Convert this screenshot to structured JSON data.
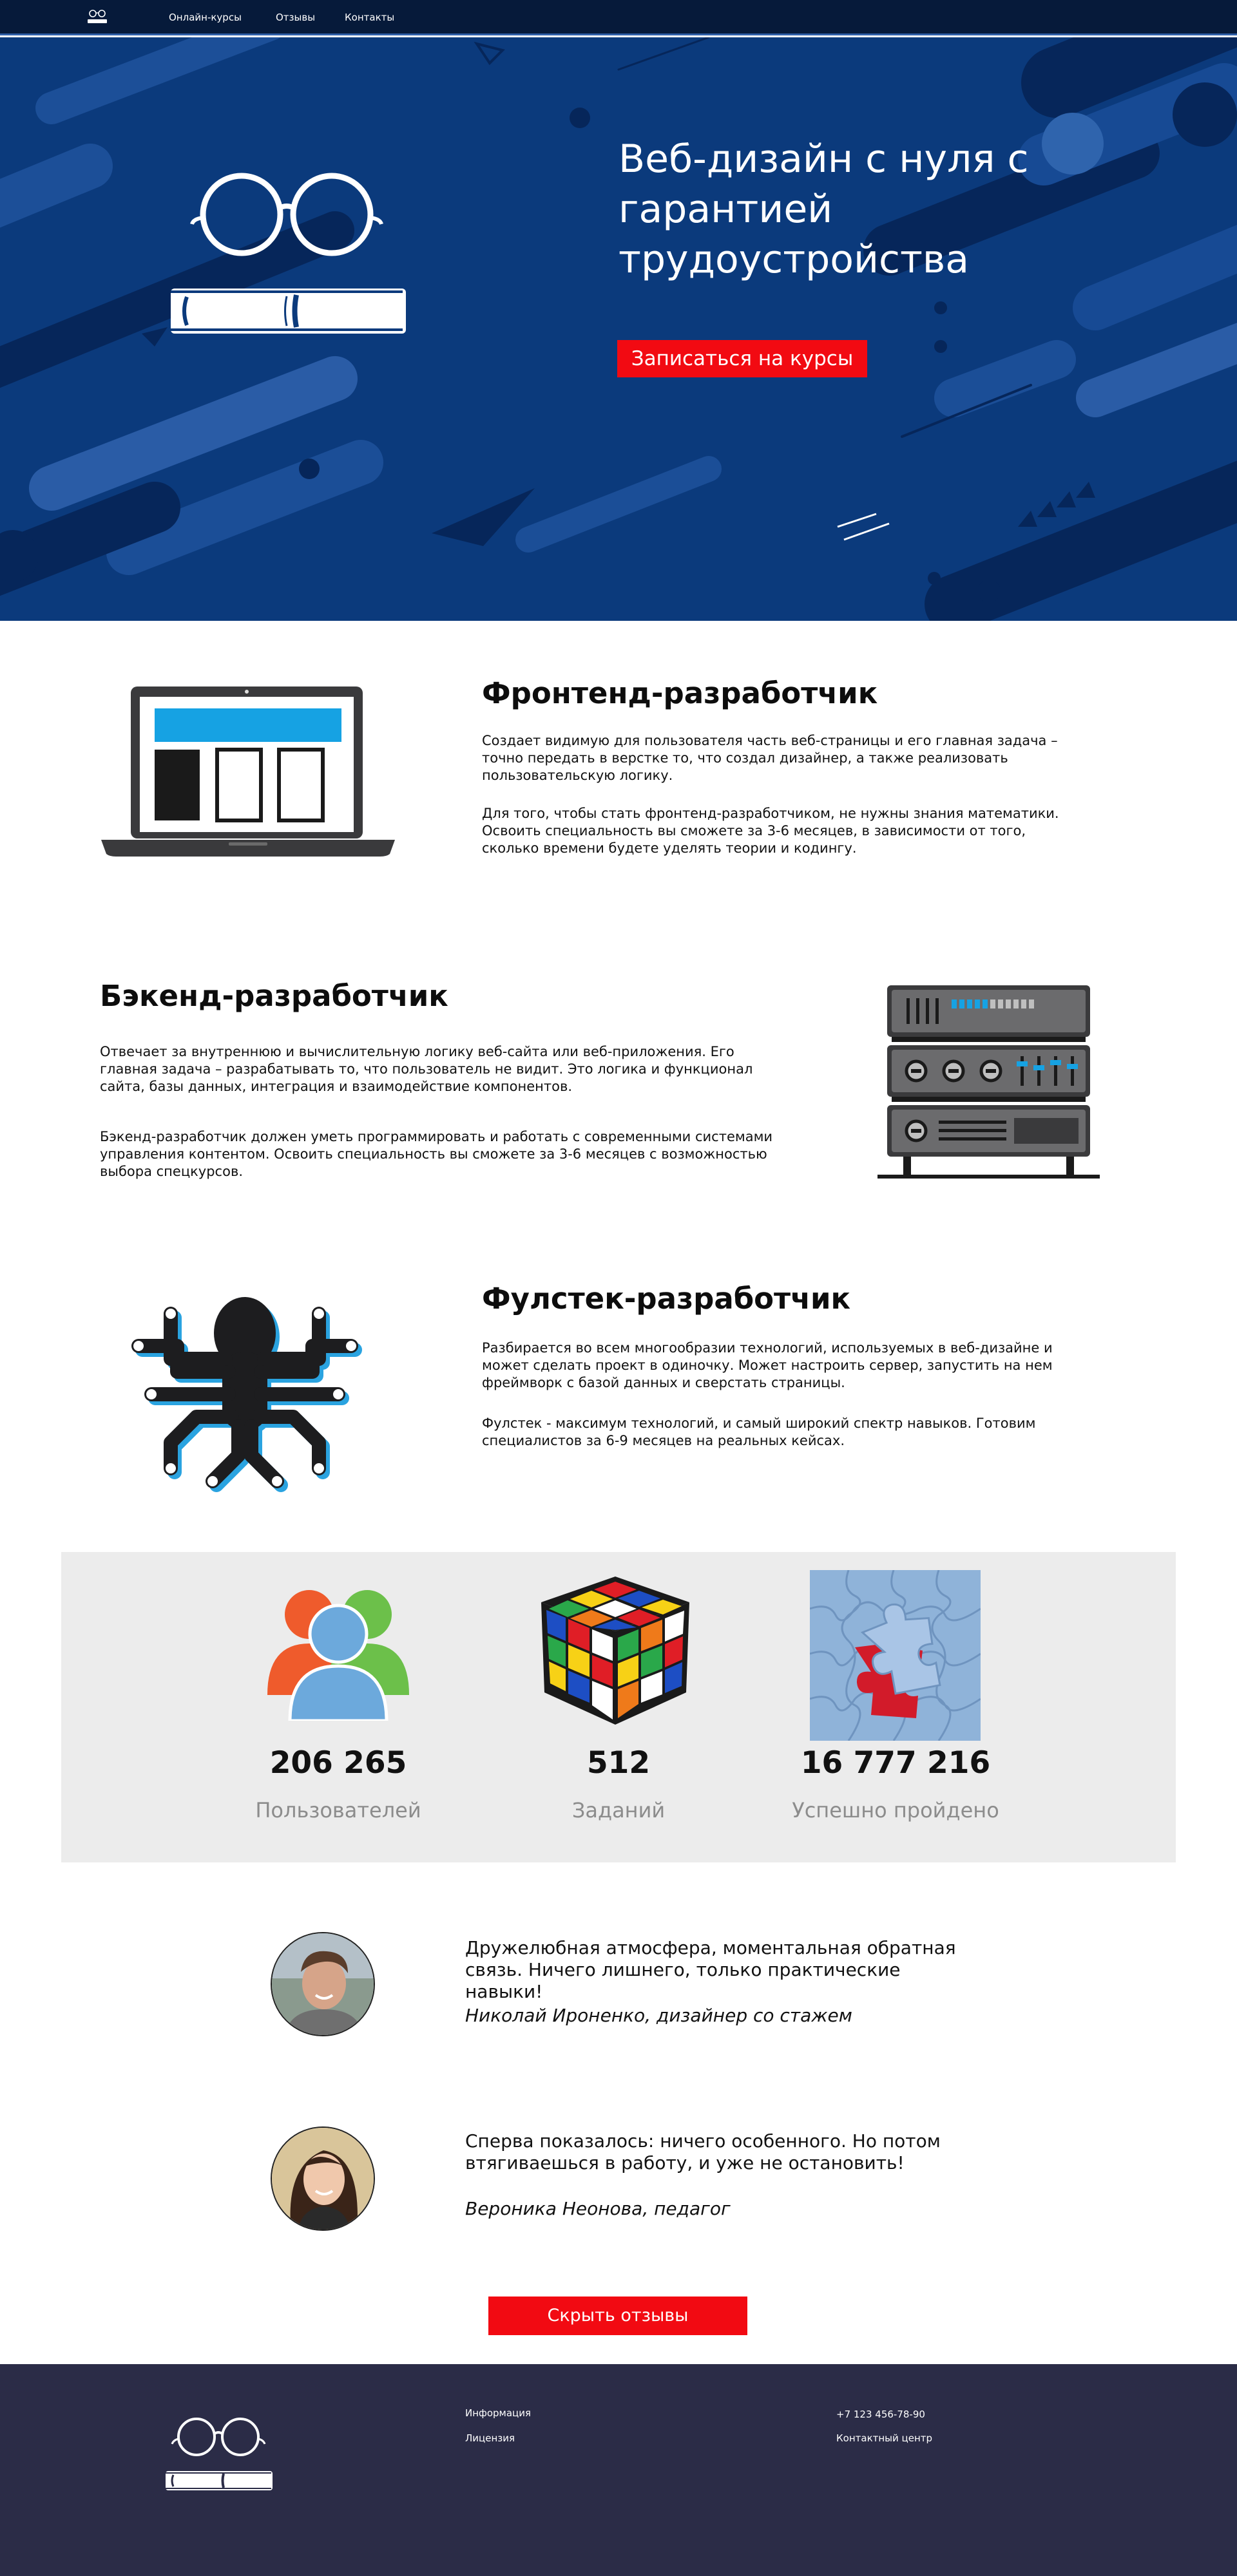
{
  "nav": {
    "links": [
      "Онлайн-курсы",
      "Отзывы",
      "Контакты"
    ]
  },
  "hero": {
    "title": "Веб-дизайн с нуля с гарантией трудоустройства",
    "button": "Записаться на курсы"
  },
  "frontend": {
    "title": "Фронтенд-разработчик",
    "p1": "Создает видимую для пользователя часть веб-страницы и его главная задача – точно передать в верстке то, что создал дизайнер, а также реализовать пользовательскую логику.",
    "p2": "Для того, чтобы стать фронтенд-разработчиком, не нужны знания математики. Освоить специальность вы сможете за 3-6 месяцев, в зависимости от того, сколько времени будете уделять теории и кодингу."
  },
  "backend": {
    "title": "Бэкенд-разработчик",
    "p1": "Отвечает за внутреннюю и вычислительную логику веб-сайта или веб-приложения. Его главная задача – разрабатывать то, что пользователь не видит. Это логика и функционал сайта, базы данных, интеграция и взаимодействие компонентов.",
    "p2": "Бэкенд-разработчик должен уметь программировать и работать с современными системами управления контентом. Освоить специальность вы сможете за 3-6 месяцев с возможностью выбора спецкурсов."
  },
  "fullstack": {
    "title": "Фулстек-разработчик",
    "p1": "Разбирается во всем многообразии технологий, используемых в веб-дизайне и может сделать проект в одиночку. Может настроить сервер, запустить на нем фреймворк с базой данных и сверстать страницы.",
    "p2": "Фулстек - максимум технологий, и самый широкий спектр навыков. Готовим специалистов за 6-9 месяцев на реальных кейсах."
  },
  "stats": [
    {
      "value": "206 265",
      "label": "Пользователей"
    },
    {
      "value": "512",
      "label": "Заданий"
    },
    {
      "value": "16 777 216",
      "label": "Успешно пройдено"
    }
  ],
  "reviews": [
    {
      "text": "Дружелюбная атмосфера, моментальная обратная связь. Ничего лишнего, только практические навыки!",
      "author": "Николай Ироненко, дизайнер со стажем"
    },
    {
      "text": "Сперва показалось: ничего особенного. Но потом втягиваешься в работу, и уже не остановить!",
      "author": "Вероника Неонова, педагог"
    }
  ],
  "hide_reviews_button": "Скрыть отзывы",
  "footer": {
    "col1": [
      "Информация",
      "Лицензия"
    ],
    "col2": [
      "+7 123 456-78-90",
      "Контактный центр"
    ]
  },
  "colors": {
    "nav_bg": "#061a3a",
    "hero_bg": "#0b3a7c",
    "accent_red": "#f20a12",
    "stats_bg": "#ececec",
    "footer_bg": "#2b2c47"
  }
}
